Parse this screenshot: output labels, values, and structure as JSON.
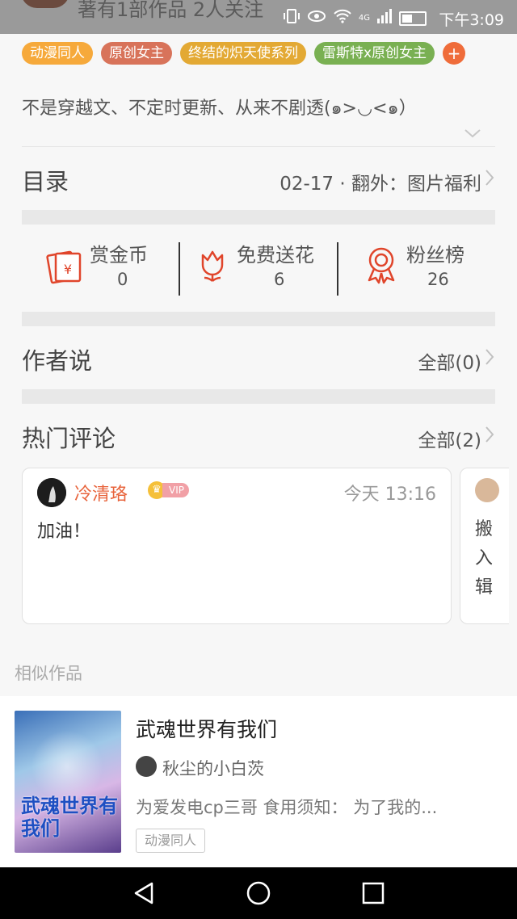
{
  "status_bar": {
    "behind_text": "著有1部作品 2人关注",
    "time": "下午3:09",
    "network": "4G"
  },
  "tags": [
    {
      "label": "动漫同人",
      "color": "#f6a93b"
    },
    {
      "label": "原创女主",
      "color": "#d8735a"
    },
    {
      "label": "终结的炽天使系列",
      "color": "#e3a934"
    },
    {
      "label": "雷斯特x原创女主",
      "color": "#79b052"
    },
    {
      "label": "+",
      "color": "#ef6c3a"
    }
  ],
  "synopsis": "不是穿越文、不定时更新、从来不剧透(๑>◡<๑）",
  "catalog": {
    "title": "目录",
    "latest": "02-17 · 翻外：图片福利"
  },
  "stats": {
    "reward": {
      "label": "赏金币",
      "value": "0"
    },
    "flowers": {
      "label": "免费送花",
      "value": "6"
    },
    "fans": {
      "label": "粉丝榜",
      "value": "26"
    }
  },
  "author_says": {
    "title": "作者说",
    "all_label": "全部(0)"
  },
  "hot_comments": {
    "title": "热门评论",
    "all_label": "全部(2)",
    "items": [
      {
        "user": "冷清珞",
        "badge": "VIP",
        "time": "今天 13:16",
        "text": "加油！"
      },
      {
        "text": "搬入辑"
      }
    ]
  },
  "similar": {
    "section_title": "相似作品",
    "book": {
      "title": "武魂世界有我们",
      "author": "秋尘的小白茨",
      "desc": "为爱发电cp三哥 食用须知： 为了我的...",
      "tag": "动漫同人",
      "cover_text": "武魂世界有我们"
    }
  }
}
